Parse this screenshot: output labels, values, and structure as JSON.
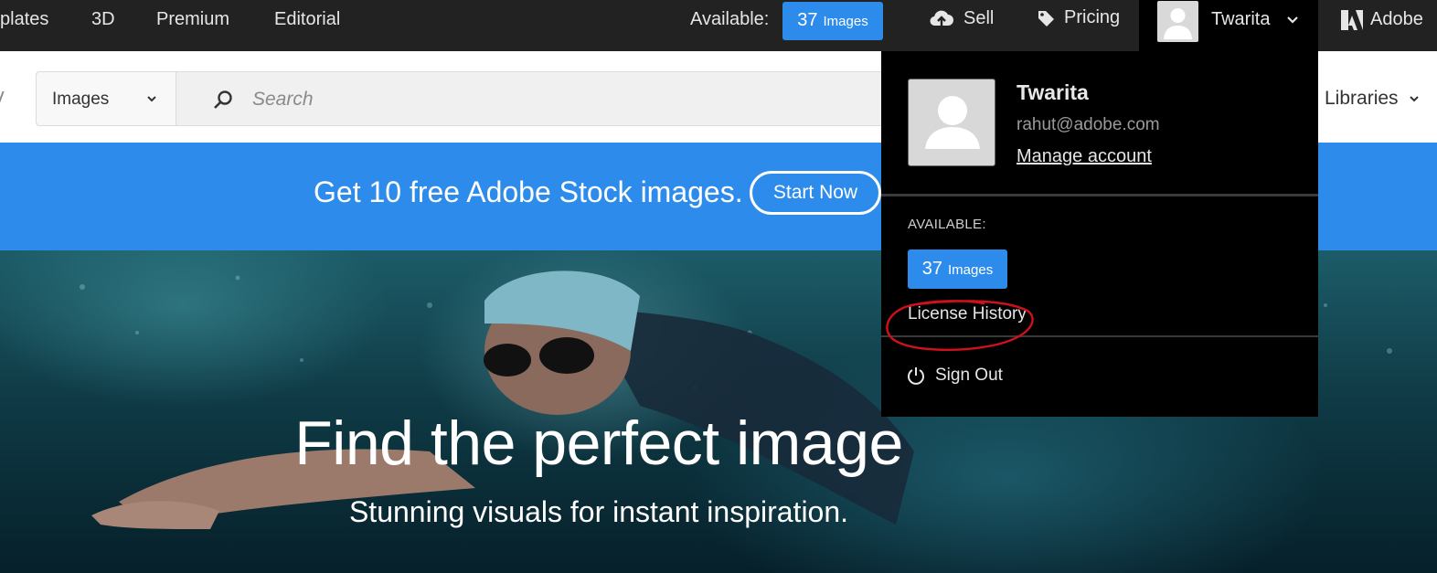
{
  "topbar": {
    "nav": [
      "plates",
      "3D",
      "Premium",
      "Editorial"
    ],
    "available_label": "Available:",
    "credits": {
      "count": "37",
      "unit": "Images"
    },
    "sell": "Sell",
    "pricing": "Pricing",
    "user_name": "Twarita",
    "brand": "Adobe"
  },
  "search": {
    "type_value": "Images",
    "placeholder": "Search",
    "libraries": "Libraries"
  },
  "promo": {
    "text": "Get 10 free Adobe Stock images.",
    "button": "Start Now"
  },
  "hero": {
    "title": "Find the perfect image",
    "subtitle": "Stunning visuals for instant inspiration."
  },
  "account_menu": {
    "name": "Twarita",
    "email": "rahut@adobe.com",
    "manage": "Manage account",
    "available_label": "AVAILABLE:",
    "credits": {
      "count": "37",
      "unit": "Images"
    },
    "license_history": "License History",
    "sign_out": "Sign Out"
  },
  "colors": {
    "topbar": "#222222",
    "accent_blue": "#2d8ceb",
    "menu_bg": "#000000",
    "annotation_red": "#d0101a"
  }
}
